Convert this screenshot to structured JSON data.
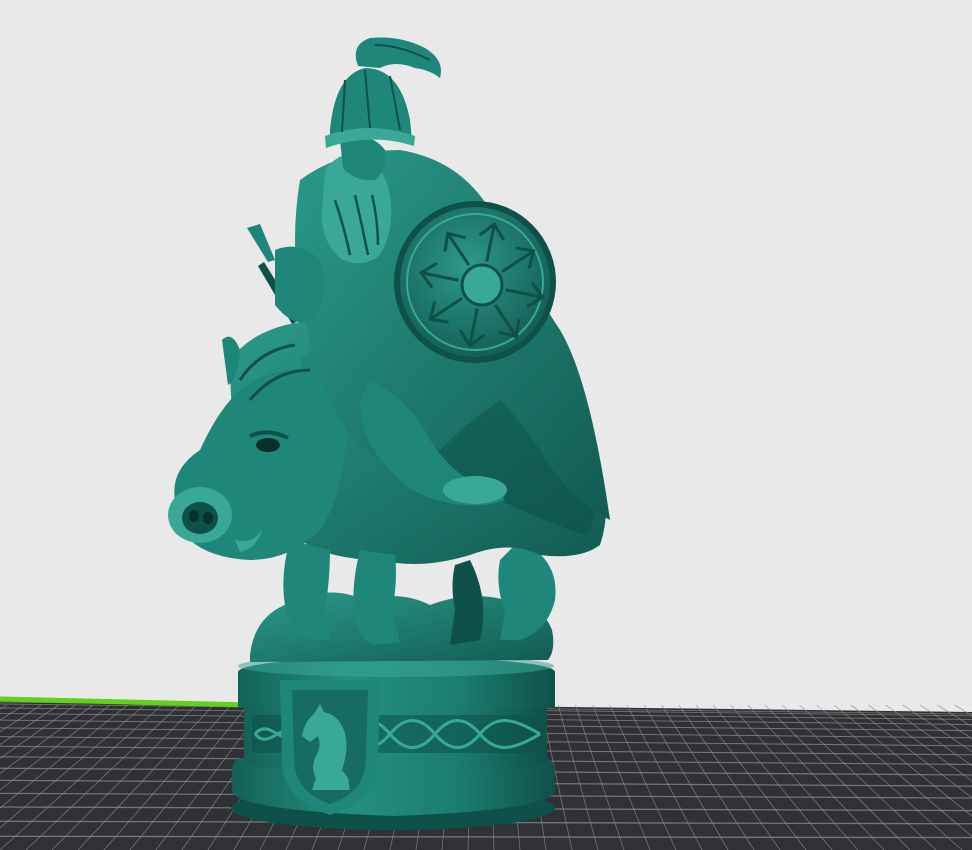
{
  "viewport": {
    "background_color": "#e9e9e9",
    "bed_color": "#2f3134",
    "grid_line_color": "#8a8d90",
    "axis_x_color": "#62d11a",
    "model_color": "#1f877a",
    "model_shadow_color": "#0d5149",
    "model_highlight_color": "#3aa897"
  },
  "model": {
    "subject": "dwarf-rider-on-boar-chess-knight",
    "emblem_icon": "chess-knight-icon"
  }
}
